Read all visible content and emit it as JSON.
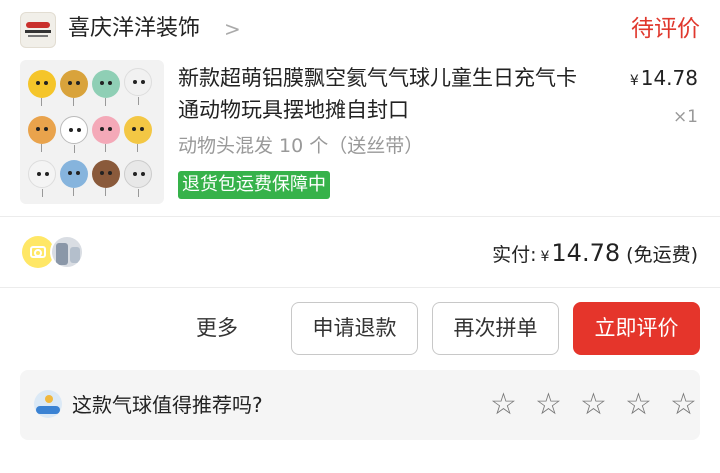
{
  "store": {
    "name": "喜庆洋洋装饰",
    "chevron": ">",
    "status": "待评价"
  },
  "product": {
    "title": "新款超萌铝膜飘空氦气气球儿童生日充气卡通动物玩具摆地摊自封口",
    "variant": "动物头混发 10 个（送丝带）",
    "guarantee": "退货包运费保障中",
    "currency": "¥",
    "price": "14.78",
    "quantity": "×1"
  },
  "payment": {
    "label": "实付:",
    "currency": "¥",
    "amount": "14.78",
    "note": "(免运费)"
  },
  "actions": {
    "more": "更多",
    "refund": "申请退款",
    "buy_again": "再次拼单",
    "review": "立即评价"
  },
  "recommend": {
    "question": "这款气球值得推荐吗?",
    "star_glyph": "☆",
    "star_count": 5
  },
  "colors": {
    "accent_red": "#e5352b",
    "guarantee_green": "#36b24a",
    "camera_yellow": "#ffe766"
  },
  "icons": {
    "camera": "camera-icon",
    "star": "star-outline-icon",
    "recommend": "surfer-emoji-icon"
  }
}
